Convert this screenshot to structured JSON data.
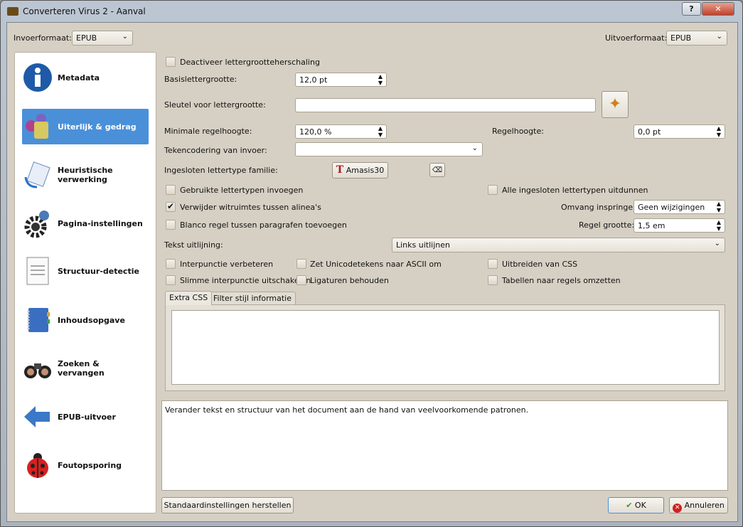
{
  "window": {
    "title": "Converteren Virus 2 - Aanval",
    "help_label": "?",
    "close_label": "✕"
  },
  "input_format": {
    "label": "Invoerformaat:",
    "value": "EPUB"
  },
  "output_format": {
    "label": "Uitvoerformaat:",
    "value": "EPUB"
  },
  "sidebar": {
    "items": [
      {
        "label": "Metadata",
        "icon": "info-icon"
      },
      {
        "label": "Uiterlijk & gedrag",
        "icon": "paint-icon",
        "selected": true
      },
      {
        "label": "Heuristische verwerking",
        "icon": "heuristic-icon"
      },
      {
        "label": "Pagina-instellingen",
        "icon": "gear-icon"
      },
      {
        "label": "Structuur-detectie",
        "icon": "document-icon"
      },
      {
        "label": "Inhoudsopgave",
        "icon": "book-icon"
      },
      {
        "label": "Zoeken & vervangen",
        "icon": "binoculars-icon"
      },
      {
        "label": "EPUB-uitvoer",
        "icon": "arrow-left-icon"
      },
      {
        "label": "Foutopsporing",
        "icon": "ladybug-icon"
      }
    ]
  },
  "form": {
    "disable_font_rescale": {
      "label": "Deactiveer lettergrootteherschaling",
      "checked": false
    },
    "base_font_size": {
      "label": "Basislettergrootte:",
      "value": "12,0 pt"
    },
    "font_size_key": {
      "label": "Sleutel voor lettergrootte:",
      "value": ""
    },
    "min_line_height": {
      "label": "Minimale regelhoogte:",
      "value": "120,0 %"
    },
    "line_height": {
      "label": "Regelhoogte:",
      "value": "0,0 pt"
    },
    "input_encoding": {
      "label": "Tekencodering van invoer:",
      "value": ""
    },
    "embed_font_family": {
      "label": "Ingesloten lettertype familie:",
      "value": "Amasis30"
    },
    "embed_used_fonts": {
      "label": "Gebruikte lettertypen invoegen",
      "checked": false
    },
    "subset_fonts": {
      "label": "Alle ingesloten lettertypen uitdunnen",
      "checked": false
    },
    "remove_spacing": {
      "label": "Verwijder witruimtes tussen alinea's",
      "checked": true
    },
    "indent_size": {
      "label": "Omvang inspringen:",
      "value": "Geen wijzigingen"
    },
    "blank_line": {
      "label": "Blanco regel tussen paragrafen toevoegen",
      "checked": false
    },
    "line_size": {
      "label": "Regel grootte:",
      "value": "1,5 em"
    },
    "text_justify": {
      "label": "Tekst uitlijning:",
      "value": "Links uitlijnen"
    },
    "smarten_punct": {
      "label": "Interpunctie verbeteren",
      "checked": false
    },
    "asciiize": {
      "label": "Zet Unicodetekens naar ASCII om",
      "checked": false
    },
    "expand_css": {
      "label": "Uitbreiden van CSS",
      "checked": false
    },
    "unsmarten_punct": {
      "label": "Slimme interpunctie uitschakelen",
      "checked": false
    },
    "keep_ligatures": {
      "label": "Ligaturen behouden",
      "checked": false
    },
    "linearize_tables": {
      "label": "Tabellen naar regels omzetten",
      "checked": false
    }
  },
  "tabs": [
    {
      "label": "Extra CSS",
      "active": true
    },
    {
      "label": "Filter stijl informatie"
    }
  ],
  "extra_css": "",
  "help_text": "Verander tekst en structuur van het document aan de hand van veelvoorkomende patronen.",
  "buttons": {
    "restore": "Standaardinstellingen herstellen",
    "ok": "OK",
    "cancel": "Annuleren"
  }
}
